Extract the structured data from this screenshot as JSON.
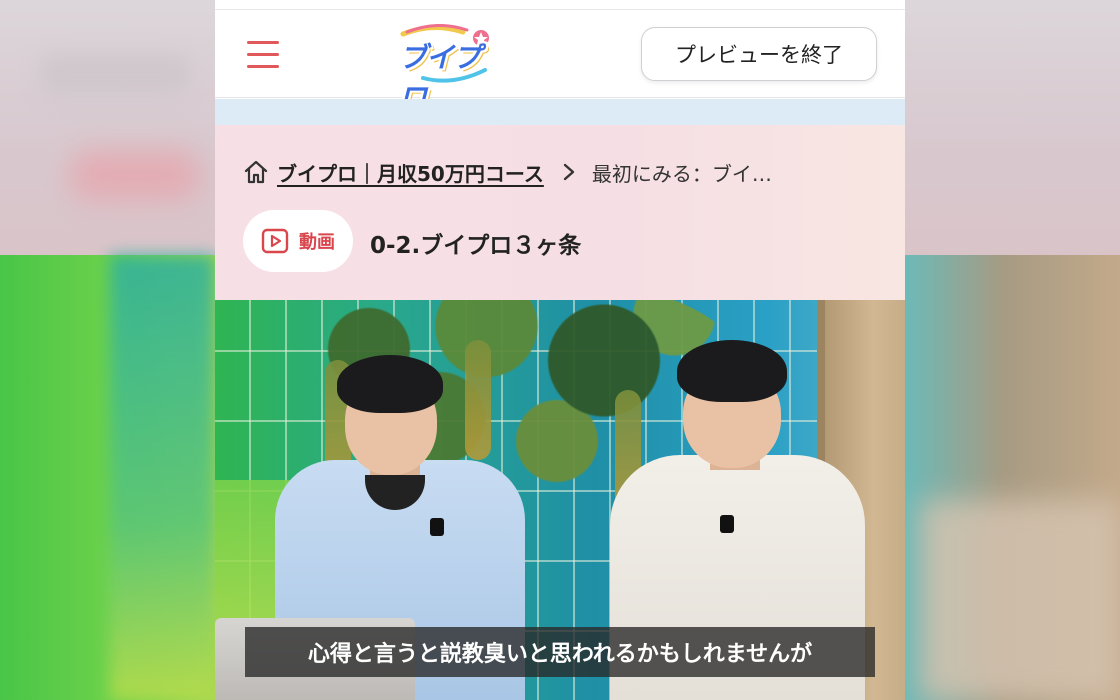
{
  "header": {
    "logo_text": "ブイプロ",
    "preview_end_label": "プレビューを終了"
  },
  "breadcrumb": {
    "course_link": "ブイプロ｜月収50万円コース",
    "current": "最初にみる：ブイ…"
  },
  "lesson": {
    "badge_label": "動画",
    "title": "0-2.ブイプロ３ヶ条"
  },
  "video": {
    "subtitle": "心得と言うと説教臭いと思われるかもしれませんが"
  },
  "colors": {
    "accent_red": "#e1585b",
    "logo_blue": "#3a6ee0"
  },
  "icons": [
    "menu-icon",
    "home-icon",
    "chevron-right-icon",
    "play-icon"
  ]
}
